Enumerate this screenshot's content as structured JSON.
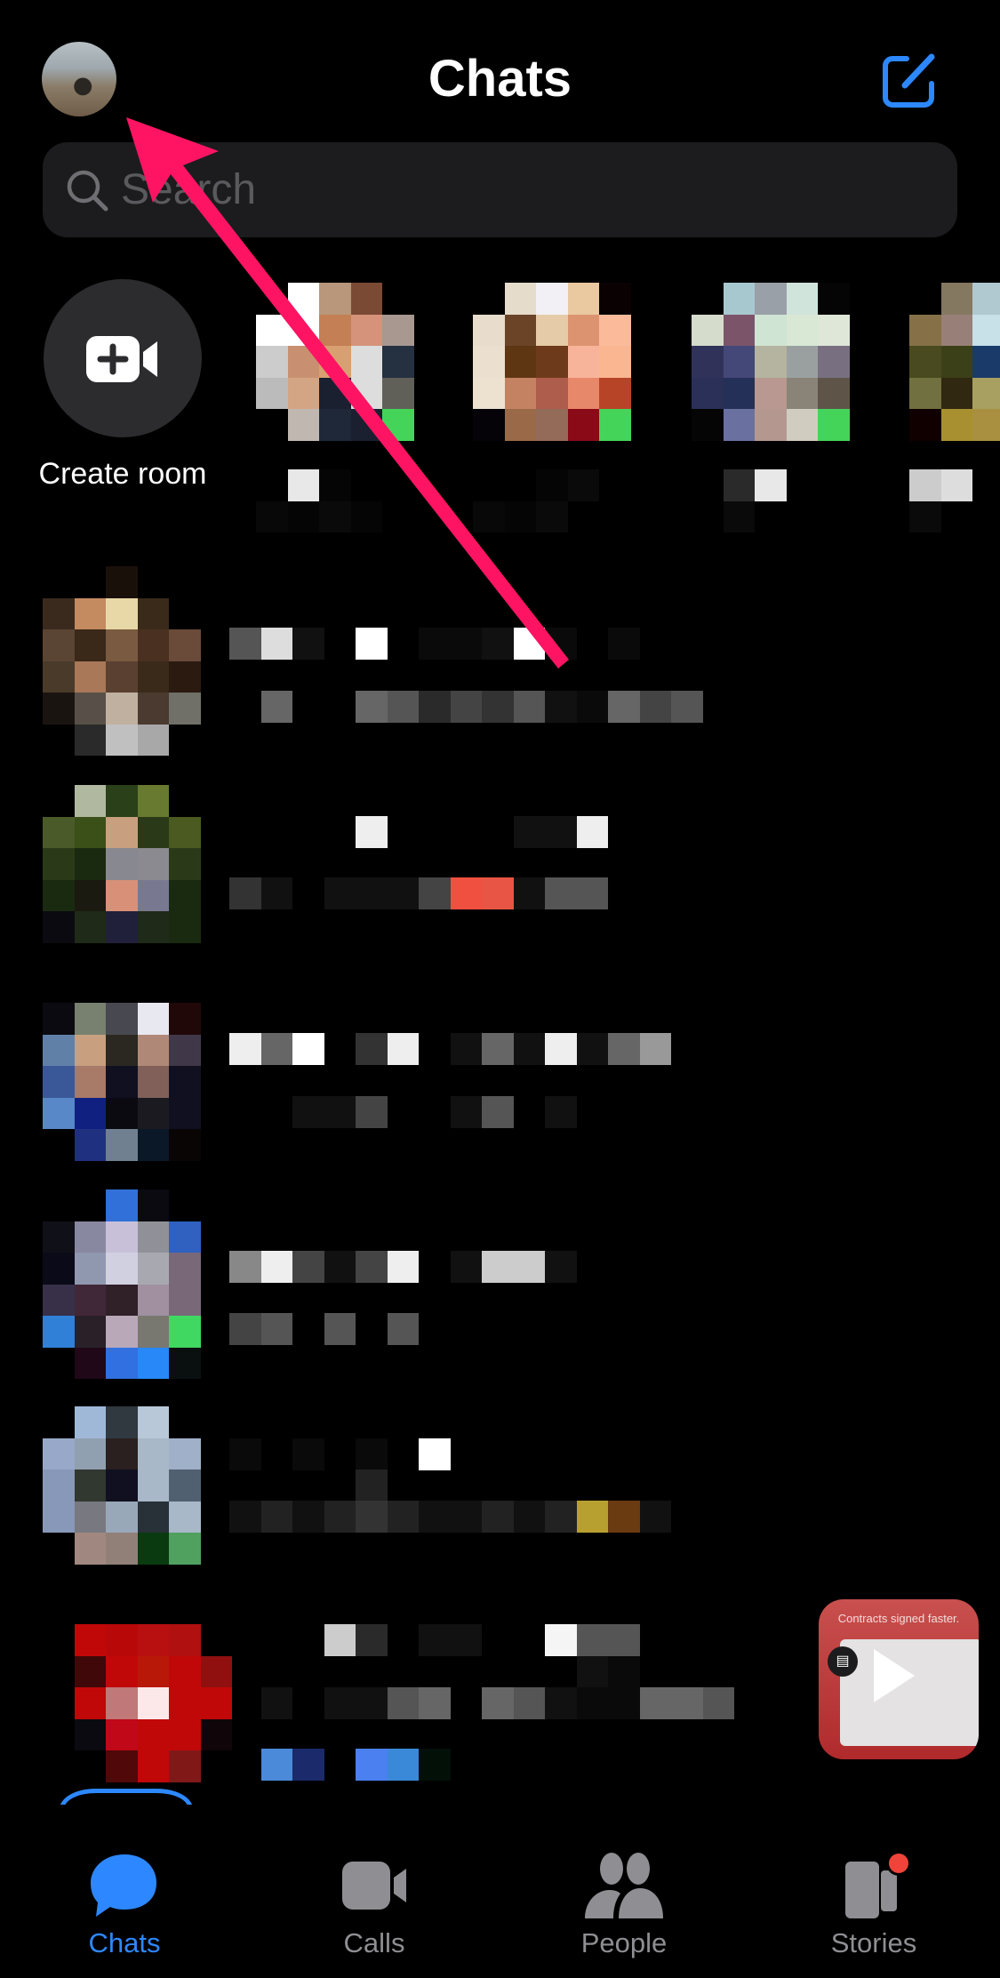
{
  "header": {
    "title": "Chats",
    "compose_icon": "compose-icon",
    "avatar_icon": "profile-avatar"
  },
  "search": {
    "placeholder": "Search"
  },
  "create_room": {
    "label": "Create room",
    "icon": "video-plus-icon"
  },
  "redacted_note_colors": {
    "online": "#45d45a"
  },
  "stories": [
    {
      "avatar": [
        [
          "",
          "#ffffff",
          "#b8977a",
          "#7a4a35",
          ""
        ],
        [
          "#ffffff",
          "#ffffff",
          "#c47f55",
          "#d4937a",
          "#a89890"
        ],
        [
          "#cccccc",
          "#c89070",
          "#d8a070",
          "#dddddd",
          "#253040"
        ],
        [
          "#bbbbbb",
          "#d4a585",
          "#1a2030",
          "#dddddd",
          "#606058"
        ],
        [
          "",
          "#c0b8b0",
          "#1e2838",
          "#1a2030",
          "#45d45a"
        ]
      ],
      "name": [
        [
          "",
          "#e8e8e8",
          "#050505",
          "",
          ""
        ],
        [
          "#080808",
          "#050505",
          "#0a0a0a",
          "#050505",
          ""
        ]
      ]
    },
    {
      "avatar": [
        [
          "",
          "#e6dccc",
          "#f2f0f5",
          "#eac8a0",
          "#0a0202"
        ],
        [
          "#e8dccc",
          "#6b4428",
          "#e6cba8",
          "#dc9470",
          "#fbbb9a"
        ],
        [
          "#ebe0d0",
          "#5e3612",
          "#6e3a1c",
          "#f8b49a",
          "#f9b690"
        ],
        [
          "#ede2cf",
          "#c48262",
          "#ae5c4c",
          "#e8886a",
          "#b84428"
        ],
        [
          "#050308",
          "#9a6a48",
          "#946a58",
          "#8a0a18",
          "#45d45a"
        ]
      ],
      "name": [
        [
          "",
          "",
          "#050505",
          "#0a0a0a",
          ""
        ],
        [
          "#080808",
          "#050505",
          "#0a0a0a",
          "",
          ""
        ]
      ]
    },
    {
      "avatar": [
        [
          "",
          "#a8c8d0",
          "#9aa0a8",
          "#d0e4dc",
          "#050505"
        ],
        [
          "#d6dccc",
          "#7c546a",
          "#d0e4d4",
          "#d8e8d4",
          "#dfe8d8"
        ],
        [
          "#30325a",
          "#444878",
          "#b4b4a0",
          "#9aa0a0",
          "#787080"
        ],
        [
          "#2a3058",
          "#253058",
          "#b89890",
          "#8a8478",
          "#5e5448"
        ],
        [
          "#050505",
          "#6a70a0",
          "#b49890",
          "#d0ccc0",
          "#45d45a"
        ]
      ],
      "name": [
        [
          "",
          "#2a2a2a",
          "#e8e8e8",
          "",
          ""
        ],
        [
          "",
          "#0a0a0a",
          "",
          "",
          ""
        ]
      ]
    },
    {
      "avatar": [
        [
          "",
          "#857860",
          "#b0c8d0"
        ],
        [
          "#857048",
          "#988078",
          "#c8e0e8"
        ],
        [
          "#4a4a20",
          "#3c4018",
          "#1a3a6a"
        ],
        [
          "#707040",
          "#302810",
          "#a8a060"
        ],
        [
          "#100000",
          "#a89030",
          "#a89040"
        ]
      ],
      "name": [
        [
          "#cccccc",
          "#dddddd"
        ],
        [
          "#0a0a0a",
          ""
        ]
      ]
    }
  ],
  "chats": [
    {
      "avatar": [
        [
          "",
          "",
          "#1a100a",
          "",
          ""
        ],
        [
          "#3a2a1e",
          "#c48a60",
          "#e8d8a8",
          "#3a2a1a",
          ""
        ],
        [
          "#5a4434",
          "#3a2818",
          "#7a5a40",
          "#4a3020",
          "#6a4a38"
        ],
        [
          "#4a3a2a",
          "#a87858",
          "#5a4030",
          "#3a2a1a",
          "#2a1a10"
        ],
        [
          "#1a1410",
          "#585048",
          "#c0b0a0",
          "#4a3a30",
          "#707068"
        ],
        [
          "",
          "#2a2a2a",
          "#c0c0c0",
          "#a8a8a8",
          ""
        ]
      ],
      "lines": [
        [
          "#555555",
          "#dddddd",
          "#111111",
          "",
          "#ffffff",
          "",
          "#0a0a0a",
          "#0a0a0a",
          "#111111",
          "#ffffff",
          "#0a0a0a",
          "",
          "#0a0a0a"
        ],
        [
          "",
          "#666666",
          "",
          "",
          "#666666",
          "#555555",
          "#2a2a2a",
          "#444444",
          "#333333",
          "#555555",
          "#111111",
          "#0a0a0a",
          "#666666",
          "#444444",
          "#555555"
        ]
      ]
    },
    {
      "avatar": [
        [
          "",
          "#b0b8a0",
          "#2a4018",
          "#687a30",
          ""
        ],
        [
          "#4a5a28",
          "#3a5018",
          "#c8a080",
          "#2a3a18",
          "#4a5a20"
        ],
        [
          "#2a3a18",
          "#1a2a10",
          "#888890",
          "#8a8a90",
          "#2a3a18"
        ],
        [
          "#1a2a10",
          "#1a1a10",
          "#d89078",
          "#787890",
          "#1a2a10"
        ],
        [
          "#0a0a10",
          "#202a18",
          "#20203a",
          "#202a18",
          "#1a2a10"
        ]
      ],
      "lines": [
        [
          "",
          "",
          "",
          "",
          "#eeeeee",
          "",
          "",
          "",
          "",
          "#111111",
          "#111111",
          "#eeeeee"
        ],
        [
          "#333333",
          "#111111",
          "",
          "#111111",
          "#111111",
          "#111111",
          "#444444",
          "#f05040",
          "#e85545",
          "#111111",
          "#555555",
          "#555555"
        ]
      ]
    },
    {
      "avatar": [
        [
          "#0a0a10",
          "#788070",
          "#484850",
          "#e8e8f0",
          "#200808"
        ],
        [
          "#6080a8",
          "#c8a080",
          "#2a2820",
          "#b08878",
          "#403848"
        ],
        [
          "#3a5898",
          "#a87a68",
          "#101020",
          "#806058",
          "#101020"
        ],
        [
          "#5888c8",
          "#102080",
          "#0a0a10",
          "#1a1a20",
          "#101020"
        ],
        [
          "",
          "#203080",
          "#708090",
          "#0a1828",
          "#0a0505"
        ]
      ],
      "lines": [
        [
          "#eeeeee",
          "#666666",
          "#ffffff",
          "",
          "#333333",
          "#eeeeee",
          "",
          "#111111",
          "#666666",
          "#111111",
          "#eeeeee",
          "#111111",
          "#666666",
          "#999999"
        ],
        [
          "",
          "",
          "#111111",
          "#111111",
          "#444444",
          "",
          "",
          "#111111",
          "#555555",
          "",
          "#111111"
        ]
      ]
    },
    {
      "avatar": [
        [
          "",
          "",
          "#3070d8",
          "#0a0a10",
          ""
        ],
        [
          "#101018",
          "#8888a0",
          "#c8c0d8",
          "#909098",
          "#3060c0"
        ],
        [
          "#0a0a18",
          "#9098b0",
          "#d0d0e0",
          "#a8a8b0",
          "#786878"
        ],
        [
          "#383048",
          "#402838",
          "#302028",
          "#a090a0",
          "#786878"
        ],
        [
          "#3080d8",
          "#2a2028",
          "#b8a8b8",
          "#787870",
          "#40d860"
        ],
        [
          "",
          "#200818",
          "#3070e0",
          "#2888f8",
          "#0a1010"
        ]
      ],
      "lines": [
        [
          "#888888",
          "#eeeeee",
          "#444444",
          "#111111",
          "#444444",
          "#eeeeee",
          "",
          "#111111",
          "#cccccc",
          "#cccccc",
          "#111111"
        ],
        [
          "#444444",
          "#555555",
          "",
          "#555555",
          "",
          "#555555"
        ]
      ]
    },
    {
      "avatar": [
        [
          "",
          "#a0b8d8",
          "#303840",
          "#b8c8d8",
          ""
        ],
        [
          "#98a8c8",
          "#90a0b0",
          "#2a2020",
          "#a8b8c8",
          "#a0b0c8"
        ],
        [
          "#8898b8",
          "#303830",
          "#101020",
          "#a8b8c8",
          "#506070"
        ],
        [
          "#8898b8",
          "#787880",
          "#98a8b8",
          "#283038",
          "#a8b8c8"
        ],
        [
          "",
          "#a08880",
          "#908078",
          "#0a3a10",
          "#50a060"
        ]
      ],
      "lines": [
        [
          "#0a0a0a",
          "",
          "#0a0a0a",
          "",
          "#0a0a0a",
          "",
          "#ffffff"
        ],
        [
          "",
          "",
          "",
          "",
          "#222222"
        ],
        [
          "#111111",
          "#222222",
          "#111111",
          "#222222",
          "#333333",
          "#222222",
          "#111111",
          "#111111",
          "#222222",
          "#111111",
          "#222222",
          "#b8a030",
          "#6a3a10",
          "#111111"
        ]
      ]
    },
    {
      "avatar": [
        [
          "",
          "#c00808",
          "#b80808",
          "#b81010",
          "#b01010",
          ""
        ],
        [
          "",
          "#400808",
          "#c00808",
          "#b81808",
          "#c00808",
          "#901010"
        ],
        [
          "",
          "#c00808",
          "#c07878",
          "#fce8e8",
          "#c00808",
          "#c00808"
        ],
        [
          "",
          "#0a0a10",
          "#c00818",
          "#c00808",
          "#c00808",
          "#100508"
        ],
        [
          "",
          "",
          "#500808",
          "#c00808",
          "#801818",
          ""
        ]
      ],
      "lines": [
        [
          "",
          "",
          "",
          "#cccccc",
          "#2a2a2a",
          "",
          "#111111",
          "#111111",
          "",
          "",
          "#f5f5f5",
          "#555555",
          "#555555"
        ],
        [
          "",
          "",
          "",
          "",
          "",
          "",
          "",
          "",
          "",
          "",
          "",
          "#111111",
          "#0a0a0a"
        ],
        [
          "",
          "#111111",
          "",
          "#111111",
          "#111111",
          "#555555",
          "#666666",
          "",
          "#666666",
          "#555555",
          "#111111",
          "#0a0a0a",
          "#0a0a0a",
          "#666666",
          "#666666",
          "#555555"
        ],
        [
          "",
          "#4a8ad8",
          "#1a2a6a",
          "",
          "#4a80f0",
          "#3a88d8",
          "#031008"
        ]
      ]
    }
  ],
  "ad": {
    "caption": "Contracts signed faster.",
    "icon": "document-icon"
  },
  "annotation": {
    "color": "#ff1464"
  },
  "tabbar": {
    "items": [
      {
        "label": "Chats",
        "icon": "chat-bubble-icon",
        "active": true
      },
      {
        "label": "Calls",
        "icon": "video-camera-icon"
      },
      {
        "label": "People",
        "icon": "people-icon"
      },
      {
        "label": "Stories",
        "icon": "stories-icon",
        "badge_color": "#f0443a"
      }
    ],
    "active_color": "#2d88ff",
    "inactive_color": "#8e8e93"
  }
}
